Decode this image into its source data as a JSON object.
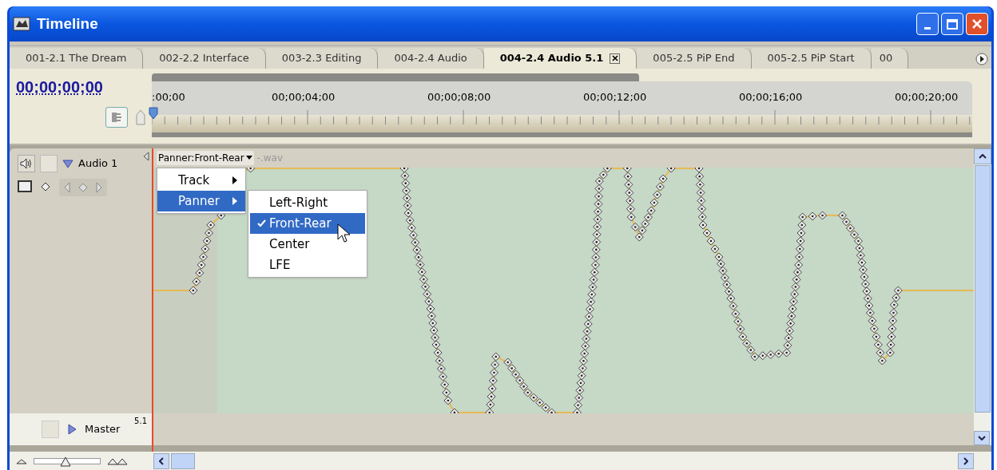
{
  "window": {
    "title": "Timeline"
  },
  "tabs": [
    {
      "label": "001-2.1 The Dream",
      "selected": false
    },
    {
      "label": "002-2.2 Interface",
      "selected": false
    },
    {
      "label": "003-2.3 Editing",
      "selected": false
    },
    {
      "label": "004-2.4 Audio",
      "selected": false
    },
    {
      "label": "004-2.4 Audio 5.1",
      "selected": true
    },
    {
      "label": "005-2.5 PiP End",
      "selected": false
    },
    {
      "label": "005-2.5 PiP Start",
      "selected": false
    },
    {
      "label": "00",
      "selected": false
    }
  ],
  "timecode": "00;00;00;00",
  "ruler": {
    "labels": [
      ":00;00",
      "00;00;04;00",
      "00;00;08;00",
      "00;00;12;00",
      "00;00;16;00",
      "00;00;20;00"
    ]
  },
  "tracks": [
    {
      "name": "Audio 1",
      "expanded": true
    }
  ],
  "master": {
    "name": "Master",
    "channels": "5.1",
    "expanded": false
  },
  "clip": {
    "panner_label": "Panner:Front-Rear",
    "file": "-.wav"
  },
  "menu": [
    {
      "label": "Track",
      "selected": false
    },
    {
      "label": "Panner",
      "selected": true
    }
  ],
  "submenu": [
    {
      "label": "Left-Right",
      "checked": false,
      "selected": false
    },
    {
      "label": "Front-Rear",
      "checked": true,
      "selected": true
    },
    {
      "label": "Center",
      "checked": false,
      "selected": false
    },
    {
      "label": "LFE",
      "checked": false,
      "selected": false
    }
  ],
  "zoom": {
    "level": 0.48
  }
}
